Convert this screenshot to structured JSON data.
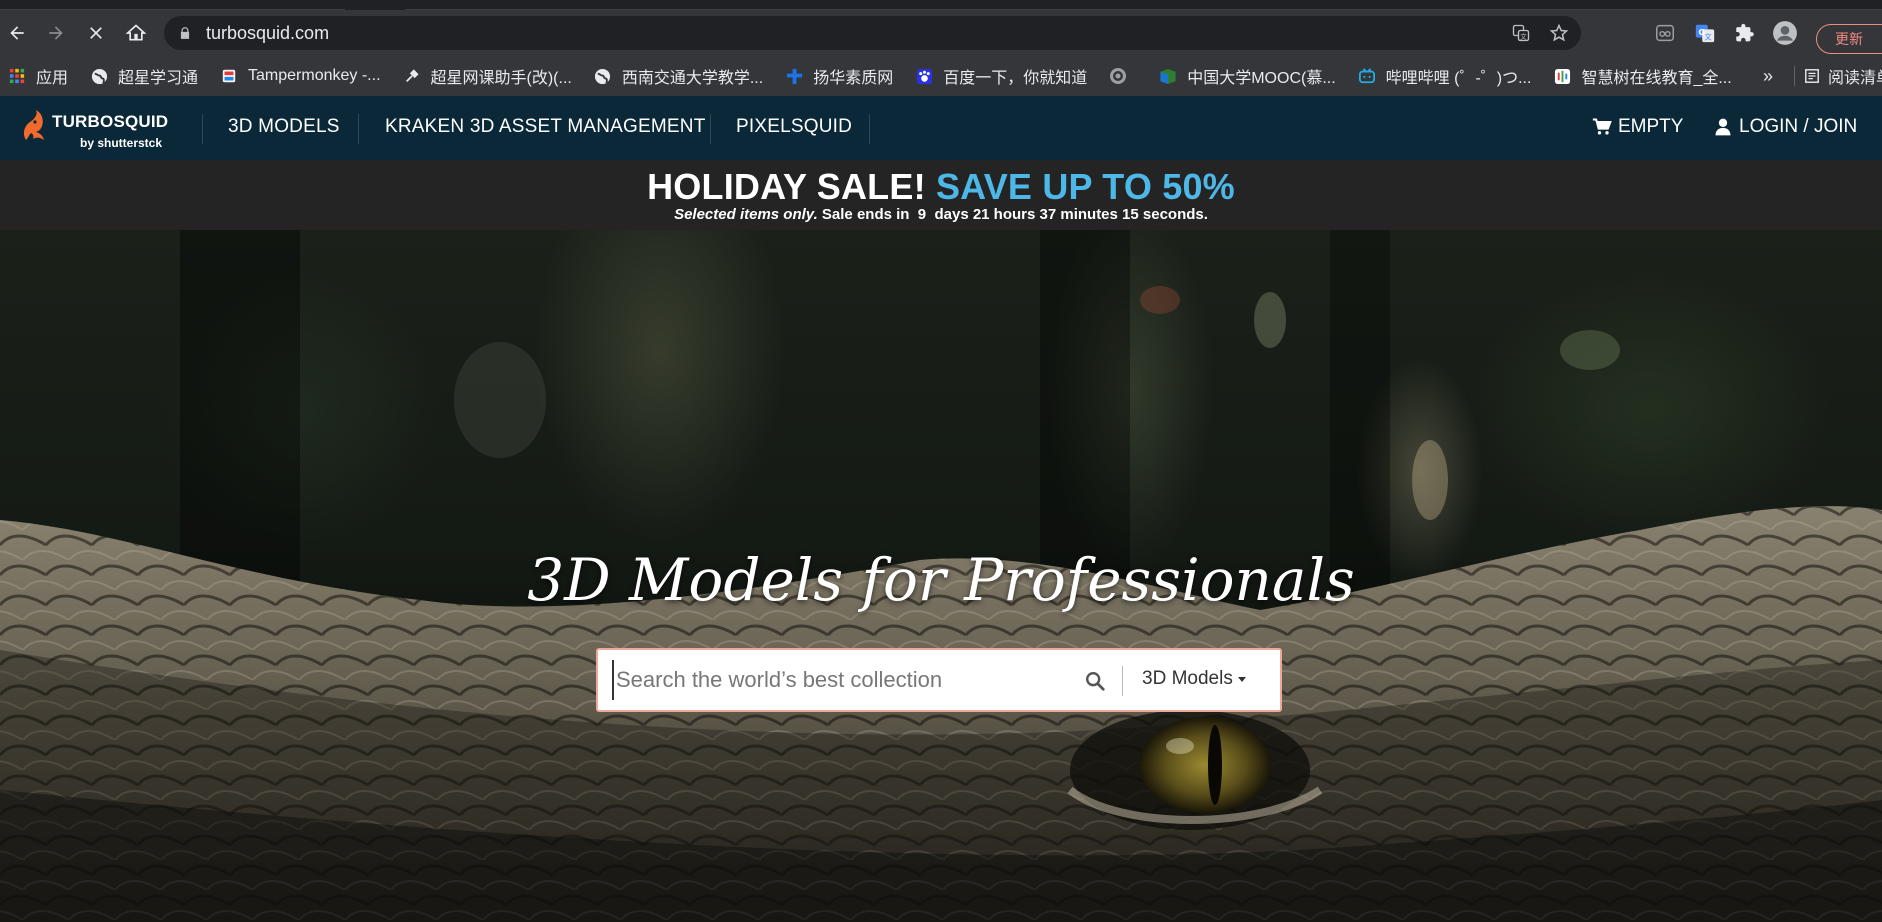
{
  "browser": {
    "url": "turbosquid.com",
    "update_label": "更新"
  },
  "bookmarks": {
    "items": [
      {
        "label": "应用",
        "icon": "apps-grid-icon"
      },
      {
        "label": "超星学习通",
        "icon": "globe-icon"
      },
      {
        "label": "Tampermonkey -...",
        "icon": "bookmark-favicon-icon"
      },
      {
        "label": "超星网课助手(改)(...",
        "icon": "wrench-icon"
      },
      {
        "label": "西南交通大学教学...",
        "icon": "globe-icon"
      },
      {
        "label": "扬华素质网",
        "icon": "cross-favicon-icon"
      },
      {
        "label": "百度一下，你就知道",
        "icon": "baidu-icon"
      },
      {
        "label": "",
        "icon": "crest-icon"
      },
      {
        "label": "中国大学MOOC(慕...",
        "icon": "mooc-icon"
      },
      {
        "label": "哔哩哔哩 (゜-゜)つ...",
        "icon": "bilibili-icon"
      },
      {
        "label": "智慧树在线教育_全...",
        "icon": "zhihuishu-icon"
      }
    ],
    "more_label": "»",
    "reading_list_label": "阅读清单"
  },
  "header": {
    "brand_word": "TURBOSQUID",
    "brand_by": "by shutterstck",
    "nav": [
      "3D MODELS",
      "KRAKEN 3D ASSET MANAGEMENT",
      "PIXELSQUID"
    ],
    "cart_label": "EMPTY",
    "login_label": "LOGIN / JOIN"
  },
  "sale": {
    "headline_main": "HOLIDAY SALE!",
    "headline_accent": "SAVE UP TO 50%",
    "sub_italic": "Selected items only.",
    "sub_text": "Sale ends in  9  days 21 hours 37 minutes 15 seconds.",
    "accent_color": "#4db8e8"
  },
  "hero": {
    "title": "3D Models for Professionals",
    "search_placeholder": "Search the world’s best collection",
    "search_type": "3D Models"
  }
}
